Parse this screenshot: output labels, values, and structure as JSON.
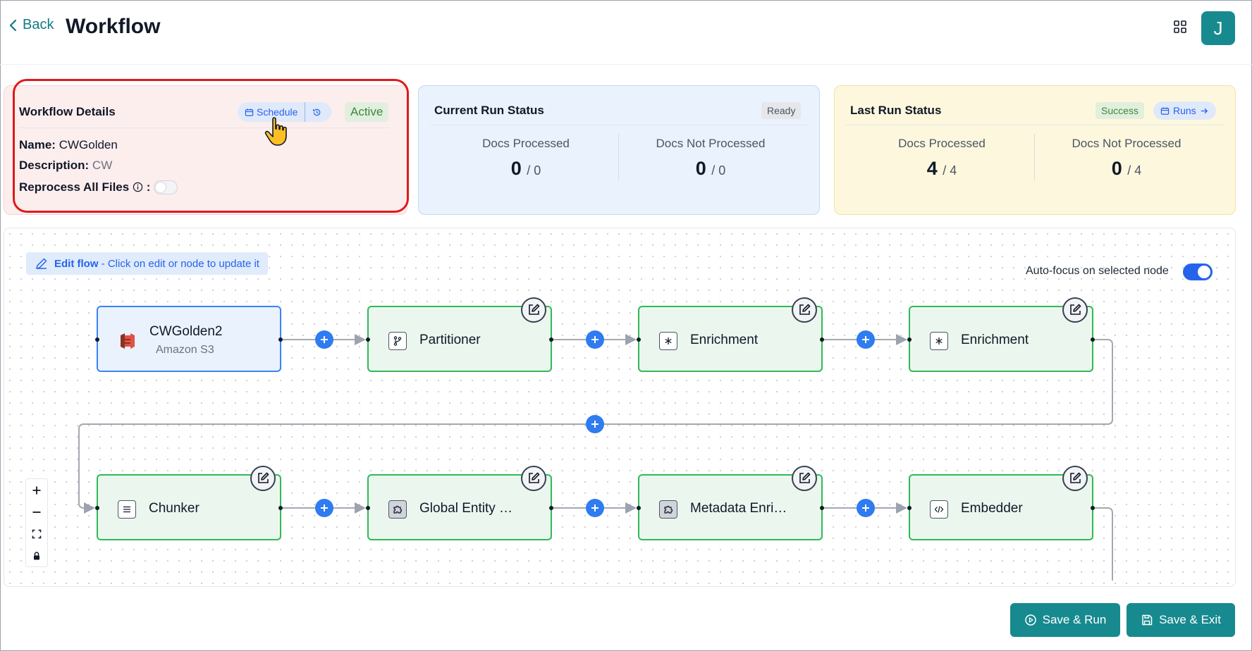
{
  "header": {
    "back_label": "Back",
    "title": "Workflow",
    "avatar_initial": "J"
  },
  "workflow_details": {
    "title": "Workflow Details",
    "schedule_label": "Schedule",
    "status_badge": "Active",
    "name_label": "Name:",
    "name_value": "CWGolden",
    "description_label": "Description:",
    "description_value": "CW",
    "reprocess_label": "Reprocess All Files",
    "reprocess_colon": ":",
    "reprocess_enabled": false
  },
  "current_run": {
    "title": "Current Run Status",
    "badge": "Ready",
    "processed_label": "Docs Processed",
    "processed_value": "0",
    "processed_total": "/ 0",
    "not_processed_label": "Docs Not Processed",
    "not_processed_value": "0",
    "not_processed_total": "/ 0"
  },
  "last_run": {
    "title": "Last Run Status",
    "badge": "Success",
    "runs_label": "Runs",
    "processed_label": "Docs Processed",
    "processed_value": "4",
    "processed_total": "/ 4",
    "not_processed_label": "Docs Not Processed",
    "not_processed_value": "0",
    "not_processed_total": "/ 4"
  },
  "canvas": {
    "edit_flow_bold": "Edit flow",
    "edit_flow_hint": "- Click on edit or node to update it",
    "autofocus_label": "Auto-focus on selected node",
    "autofocus_enabled": true,
    "nodes": {
      "source": {
        "label": "CWGolden2",
        "sub": "Amazon S3",
        "icon": "amazon-s3-icon"
      },
      "n1": {
        "label": "Partitioner",
        "icon": "branch-icon"
      },
      "n2": {
        "label": "Enrichment",
        "icon": "asterisk-icon"
      },
      "n3": {
        "label": "Enrichment",
        "icon": "asterisk-icon"
      },
      "n4": {
        "label": "Chunker",
        "icon": "lines-icon"
      },
      "n5": {
        "label": "Global Entity …",
        "icon": "puzzle-icon"
      },
      "n6": {
        "label": "Metadata Enri…",
        "icon": "puzzle-icon"
      },
      "n7": {
        "label": "Embedder",
        "icon": "code-icon"
      }
    }
  },
  "footer": {
    "save_run_label": "Save & Run",
    "save_exit_label": "Save & Exit"
  },
  "colors": {
    "teal": "#178a8f",
    "blue": "#2f7bf0",
    "node_green": "#2fba56",
    "highlight_red": "#e01a1a"
  }
}
